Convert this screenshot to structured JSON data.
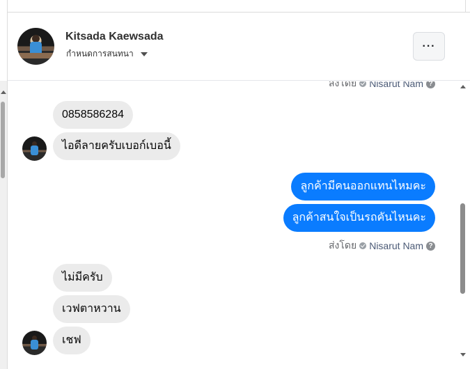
{
  "header": {
    "name": "Kitsada Kaewsada",
    "subtitle": "กำหนดการสนทนา",
    "more_label": "···"
  },
  "messages": [
    {
      "type": "sent_by",
      "prefix": "ส่งโดย",
      "agent": "Nisarut Nam"
    },
    {
      "type": "incoming",
      "text": "0858586284"
    },
    {
      "type": "incoming",
      "text": "ไอดีลายครับเบอก์เบอนี้"
    },
    {
      "type": "outgoing",
      "text": "ลูกค้ามีคนออกแทนไหมคะ"
    },
    {
      "type": "outgoing",
      "text": "ลูกค้าสนใจเป็นรถคันไหนคะ"
    },
    {
      "type": "sent_by",
      "prefix": "ส่งโดย",
      "agent": "Nisarut Nam"
    },
    {
      "type": "incoming",
      "text": "ไม่มีครับ"
    },
    {
      "type": "incoming",
      "text": "เวฟตาหวาน"
    },
    {
      "type": "incoming",
      "text": "เชฟ"
    }
  ],
  "icons": {
    "verified": "check-circle-icon",
    "help": "question-icon",
    "caret": "caret-down-icon"
  },
  "colors": {
    "outgoing_bubble": "#0a7cff",
    "incoming_bubble": "#ebebeb"
  }
}
